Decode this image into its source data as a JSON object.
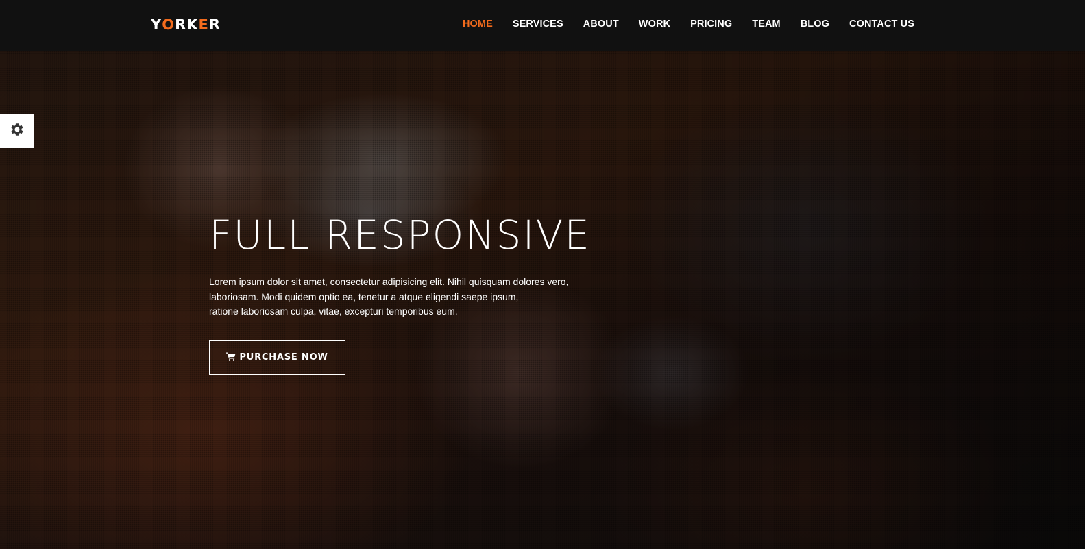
{
  "header": {
    "logo": {
      "letters": [
        "Y",
        "O",
        "R",
        "K",
        "E",
        "R"
      ],
      "letter_colors": [
        "#ffffff",
        "#f26b1d",
        "#ffffff",
        "#ffffff",
        "#f26b1d",
        "#ffffff"
      ]
    },
    "nav": [
      {
        "label": "HOME",
        "active": true
      },
      {
        "label": "SERVICES",
        "active": false
      },
      {
        "label": "ABOUT",
        "active": false
      },
      {
        "label": "WORK",
        "active": false
      },
      {
        "label": "PRICING",
        "active": false
      },
      {
        "label": "TEAM",
        "active": false
      },
      {
        "label": "BLOG",
        "active": false
      },
      {
        "label": "CONTACT US",
        "active": false
      }
    ]
  },
  "hero": {
    "title": "FULL RESPONSIVE",
    "text_lines": [
      "Lorem ipsum dolor sit amet, consectetur adipisicing elit. Nihil quisquam dolores vero,",
      "laboriosam. Modi quidem optio ea, tenetur a atque eligendi saepe ipsum,",
      "ratione laboriosam culpa, vitae, excepturi temporibus eum."
    ],
    "button_label": "PURCHASE NOW",
    "button_icon": "shopping-cart-icon"
  },
  "settings_panel_icon": "gear-icon",
  "colors": {
    "accent": "#f26b1d",
    "navbar_bg": "#111111",
    "text": "#ffffff"
  }
}
